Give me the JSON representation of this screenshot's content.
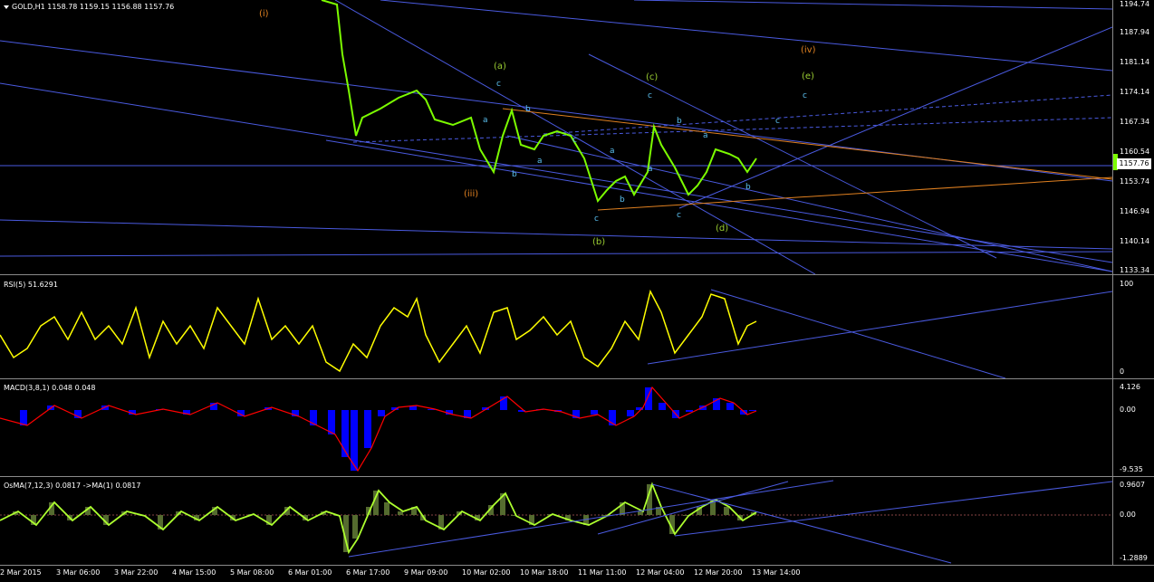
{
  "symbol_header": "GOLD,H1  1158.78 1159.15 1156.88 1157.76",
  "current_price": "1157.76",
  "price_axis": [
    "1194.74",
    "1187.94",
    "1181.14",
    "1174.14",
    "1167.34",
    "1160.54",
    "1153.74",
    "1146.94",
    "1140.14",
    "1133.34"
  ],
  "rsi": {
    "label": "RSI(5) 51.6291",
    "top": "100",
    "bottom": "0"
  },
  "macd": {
    "label": "MACD(3,8,1) 0.048 0.048",
    "top": "4.126",
    "mid": "0.00",
    "bottom": "-9.535"
  },
  "osma": {
    "label": "OsMA(7,12,3) 0.0817  ->MA(1) 0.0817",
    "top": "0.9607",
    "mid": "0.00",
    "bottom": "-1.2889"
  },
  "time_axis": [
    "2 Mar 2015",
    "3 Mar 06:00",
    "3 Mar 22:00",
    "4 Mar 15:00",
    "5 Mar 08:00",
    "6 Mar 01:00",
    "6 Mar 17:00",
    "9 Mar 09:00",
    "10 Mar 02:00",
    "10 Mar 18:00",
    "11 Mar 11:00",
    "12 Mar 04:00",
    "12 Mar 20:00",
    "13 Mar 14:00"
  ],
  "wave_labels": {
    "i": "(i)",
    "iii": "(iii)",
    "iv": "(iv)",
    "a_big": "(a)",
    "b_big": "(b)",
    "c_big": "(c)",
    "d_big": "(d)",
    "e_big": "(e)",
    "c": "c",
    "b": "b",
    "a": "a"
  },
  "colors": {
    "background": "#000000",
    "candles": "#7CFC00",
    "trendline": "#4A5ADF",
    "orange": "#E08020",
    "rsi": "#FFFF00",
    "macd_hist": "#0000FF",
    "macd_signal": "#FF0000",
    "osma_hist": "#556B2F",
    "osma_line": "#ADFF2F"
  }
}
